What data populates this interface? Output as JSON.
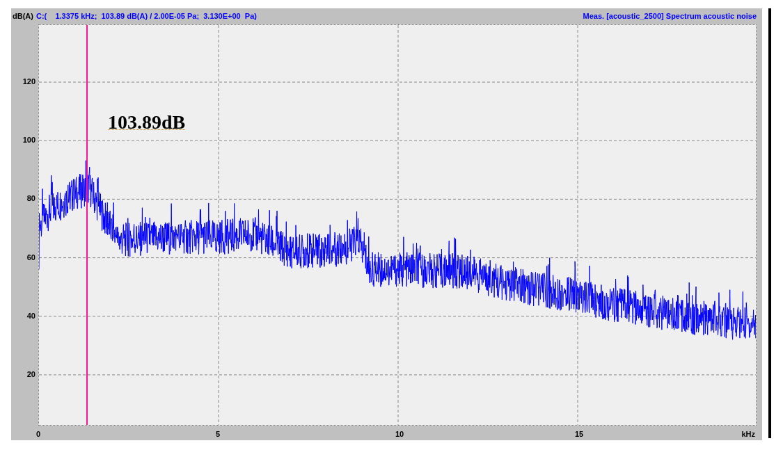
{
  "header": {
    "unit_label": "dB(A)",
    "cursor_readout": "C:(    1.3375 kHz;  103.89 dB(A) / 2.00E-05 Pa;  3.130E+00  Pa)",
    "measurement_title": "Meas. [acoustic_2500] Spectrum acoustic noise"
  },
  "y_axis": {
    "labels": [
      "120",
      "100",
      "80",
      "60",
      "40",
      "20"
    ]
  },
  "x_axis": {
    "labels": [
      "0",
      "5",
      "10",
      "15"
    ],
    "unit": "kHz"
  },
  "cursor": {
    "level": 0.066875
  },
  "annotation": "103.89dB"
}
